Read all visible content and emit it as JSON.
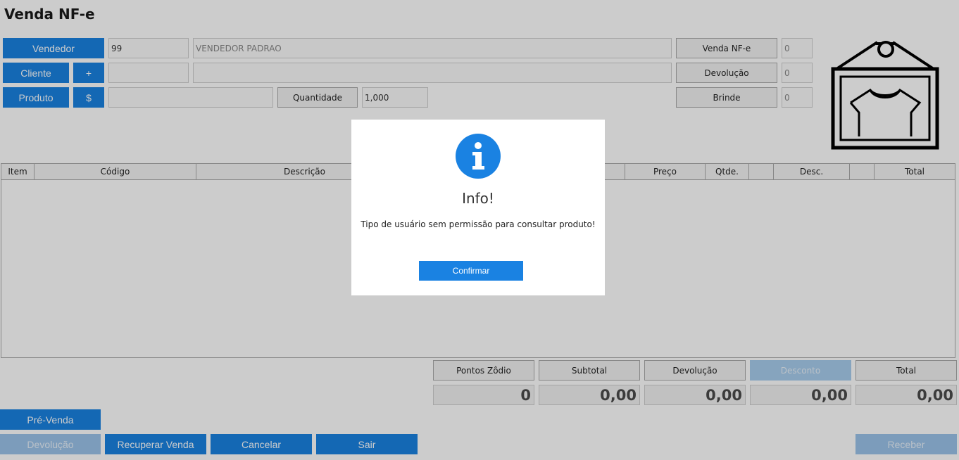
{
  "page": {
    "title": "Venda NF-e"
  },
  "buttons": {
    "vendedor": "Vendedor",
    "cliente": "Cliente",
    "add": "+",
    "produto": "Produto",
    "price": "$",
    "quantidade": "Quantidade",
    "venda_nfe": "Venda NF-e",
    "devolucao": "Devolução",
    "brinde": "Brinde"
  },
  "fields": {
    "vendedor_code": "99",
    "vendedor_name": "VENDEDOR PADRAO",
    "cliente_code": "",
    "cliente_name": "",
    "produto_code": "",
    "quantidade": "1,000",
    "venda_nfe_count": "0",
    "devolucao_count": "0",
    "brinde_count": "0"
  },
  "table": {
    "columns": [
      "Item",
      "Código",
      "Descrição",
      "",
      "Preço",
      "Qtde.",
      "",
      "Desc.",
      "",
      "Total"
    ]
  },
  "totals": {
    "labels": [
      "Pontos Zôdio",
      "Subtotal",
      "Devolução",
      "Desconto",
      "Total"
    ],
    "values": [
      "0",
      "0,00",
      "0,00",
      "0,00",
      "0,00"
    ]
  },
  "footer": {
    "pre_venda": "Pré-Venda",
    "devolucao": "Devolução",
    "recuperar": "Recuperar Venda",
    "cancelar": "Cancelar",
    "sair": "Sair",
    "receber": "Receber"
  },
  "modal": {
    "title": "Info!",
    "message": "Tipo de usuário sem permissão para consultar produto!",
    "confirm": "Confirmar"
  },
  "colors": {
    "accent": "#1a82e2",
    "disabled": "#9cc4ea"
  },
  "icons": {
    "logo": "shirt-frame-icon",
    "info": "info-icon"
  }
}
